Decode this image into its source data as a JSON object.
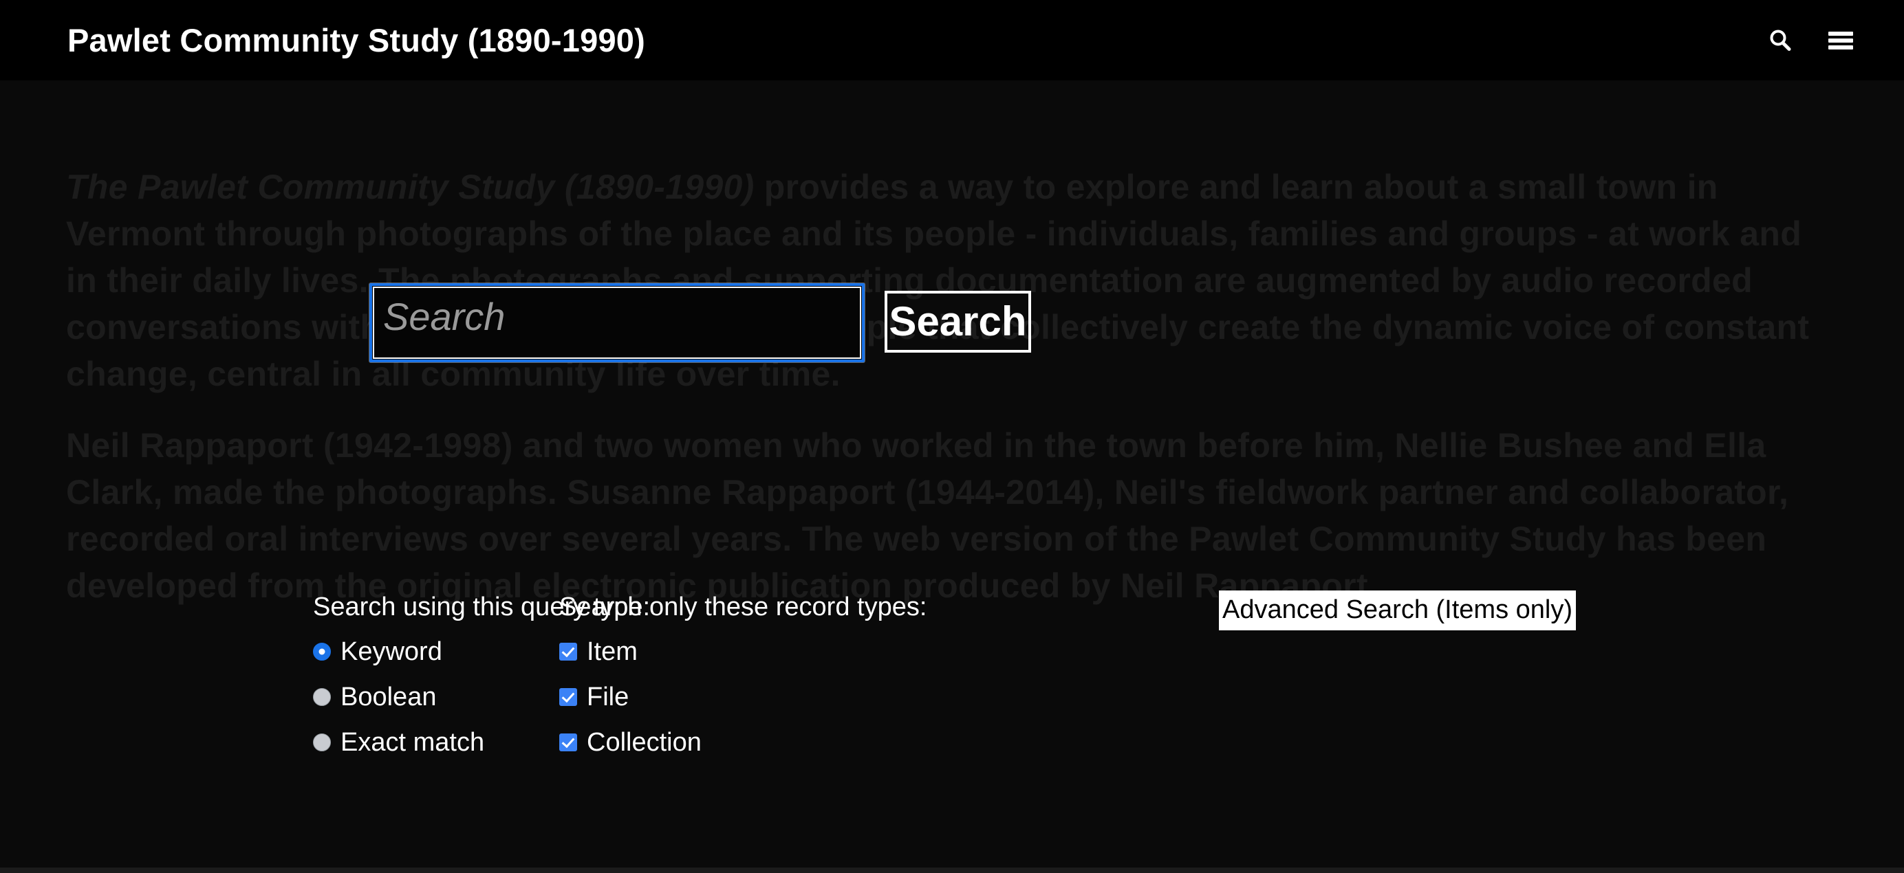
{
  "header": {
    "title": "Pawlet Community Study (1890-1990)",
    "search_icon": "search-icon",
    "menu_icon": "hamburger-menu-icon"
  },
  "intro": {
    "paragraph1_emphasis": "The Pawlet Community Study (1890-1990)",
    "paragraph1_rest": " provides a way to explore and learn about a small town in Vermont through photographs of the place and its people - individuals, families and groups - at work and in their daily lives. The photographs and supporting documentation are augmented by audio recorded conversations with older and younger townspeople that collectively create the dynamic voice of constant change, central in all community life over time.",
    "paragraph2": "Neil Rappaport (1942-1998) and two women who worked in the town before him, Nellie Bushee and Ella Clark, made the photographs. Susanne Rappaport (1944-2014), Neil's fieldwork partner and collaborator, recorded oral interviews over several years. The web version of the Pawlet Community Study has been developed from the original electronic publication produced by Neil Rappaport."
  },
  "search": {
    "placeholder": "Search",
    "value": "",
    "submit_label": "Search",
    "advanced_link_label": "Advanced Search (Items only)"
  },
  "options": {
    "query_type": {
      "title": "Search using this query type:",
      "items": [
        {
          "label": "Keyword",
          "checked": true
        },
        {
          "label": "Boolean",
          "checked": false
        },
        {
          "label": "Exact match",
          "checked": false
        }
      ]
    },
    "record_types": {
      "title": "Search only these record types:",
      "items": [
        {
          "label": "Item",
          "checked": true
        },
        {
          "label": "File",
          "checked": true
        },
        {
          "label": "Collection",
          "checked": true
        }
      ]
    }
  },
  "colors": {
    "header_bg": "#000000",
    "page_bg": "#0a0a0a",
    "prose_text": "#1c1c1c",
    "focus_blue": "#1a73e8",
    "checkbox_blue": "#3b82f6",
    "text_white": "#ffffff"
  }
}
